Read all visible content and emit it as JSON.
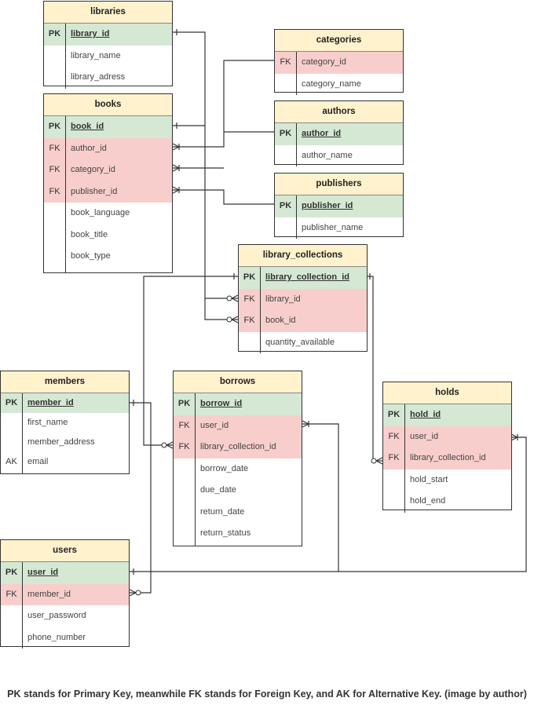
{
  "tables": [
    {
      "name": "libraries",
      "rows": [
        {
          "key": "PK",
          "field": "library_id"
        },
        {
          "key": "",
          "field": "library_name"
        },
        {
          "key": "",
          "field": "library_adress"
        }
      ]
    },
    {
      "name": "books",
      "rows": [
        {
          "key": "PK",
          "field": "book_id"
        },
        {
          "key": "FK",
          "field": "author_id"
        },
        {
          "key": "FK",
          "field": "category_id"
        },
        {
          "key": "FK",
          "field": "publisher_id"
        },
        {
          "key": "",
          "field": "book_language"
        },
        {
          "key": "",
          "field": "book_title"
        },
        {
          "key": "",
          "field": "book_type"
        }
      ]
    },
    {
      "name": "categories",
      "rows": [
        {
          "key": "FK",
          "field": "category_id"
        },
        {
          "key": "",
          "field": "category_name"
        }
      ]
    },
    {
      "name": "authors",
      "rows": [
        {
          "key": "PK",
          "field": "author_id"
        },
        {
          "key": "",
          "field": "author_name"
        }
      ]
    },
    {
      "name": "publishers",
      "rows": [
        {
          "key": "PK",
          "field": "publisher_id"
        },
        {
          "key": "",
          "field": "publisher_name"
        }
      ]
    },
    {
      "name": "library_collections",
      "rows": [
        {
          "key": "PK",
          "field": "library_collection_id"
        },
        {
          "key": "FK",
          "field": "library_id"
        },
        {
          "key": "FK",
          "field": "book_id"
        },
        {
          "key": "",
          "field": "quantity_available"
        }
      ]
    },
    {
      "name": "members",
      "rows": [
        {
          "key": "PK",
          "field": "member_id"
        },
        {
          "key": "",
          "field": "first_name"
        },
        {
          "key": "",
          "field": "member_address"
        },
        {
          "key": "AK",
          "field": "email"
        }
      ]
    },
    {
      "name": "borrows",
      "rows": [
        {
          "key": "PK",
          "field": "borrow_id"
        },
        {
          "key": "FK",
          "field": "user_id"
        },
        {
          "key": "FK",
          "field": "library_collection_id"
        },
        {
          "key": "",
          "field": "borrow_date"
        },
        {
          "key": "",
          "field": "due_date"
        },
        {
          "key": "",
          "field": "return_date"
        },
        {
          "key": "",
          "field": "return_status"
        }
      ]
    },
    {
      "name": "holds",
      "rows": [
        {
          "key": "PK",
          "field": "hold_id"
        },
        {
          "key": "FK",
          "field": "user_id"
        },
        {
          "key": "FK",
          "field": "library_collection_id"
        },
        {
          "key": "",
          "field": "hold_start"
        },
        {
          "key": "",
          "field": "hold_end"
        }
      ]
    },
    {
      "name": "users",
      "rows": [
        {
          "key": "PK",
          "field": "user_id"
        },
        {
          "key": "FK",
          "field": "member_id"
        },
        {
          "key": "",
          "field": "user_password"
        },
        {
          "key": "",
          "field": "phone_number"
        }
      ]
    }
  ],
  "colors": {
    "header": "#fff2cc",
    "primary_key": "#d5e8d4",
    "foreign_key": "#f8cecc",
    "line": "#333333"
  },
  "caption": "PK stands for Primary Key, meanwhile FK stands for Foreign Key, and AK for Alternative Key. (image by author)"
}
